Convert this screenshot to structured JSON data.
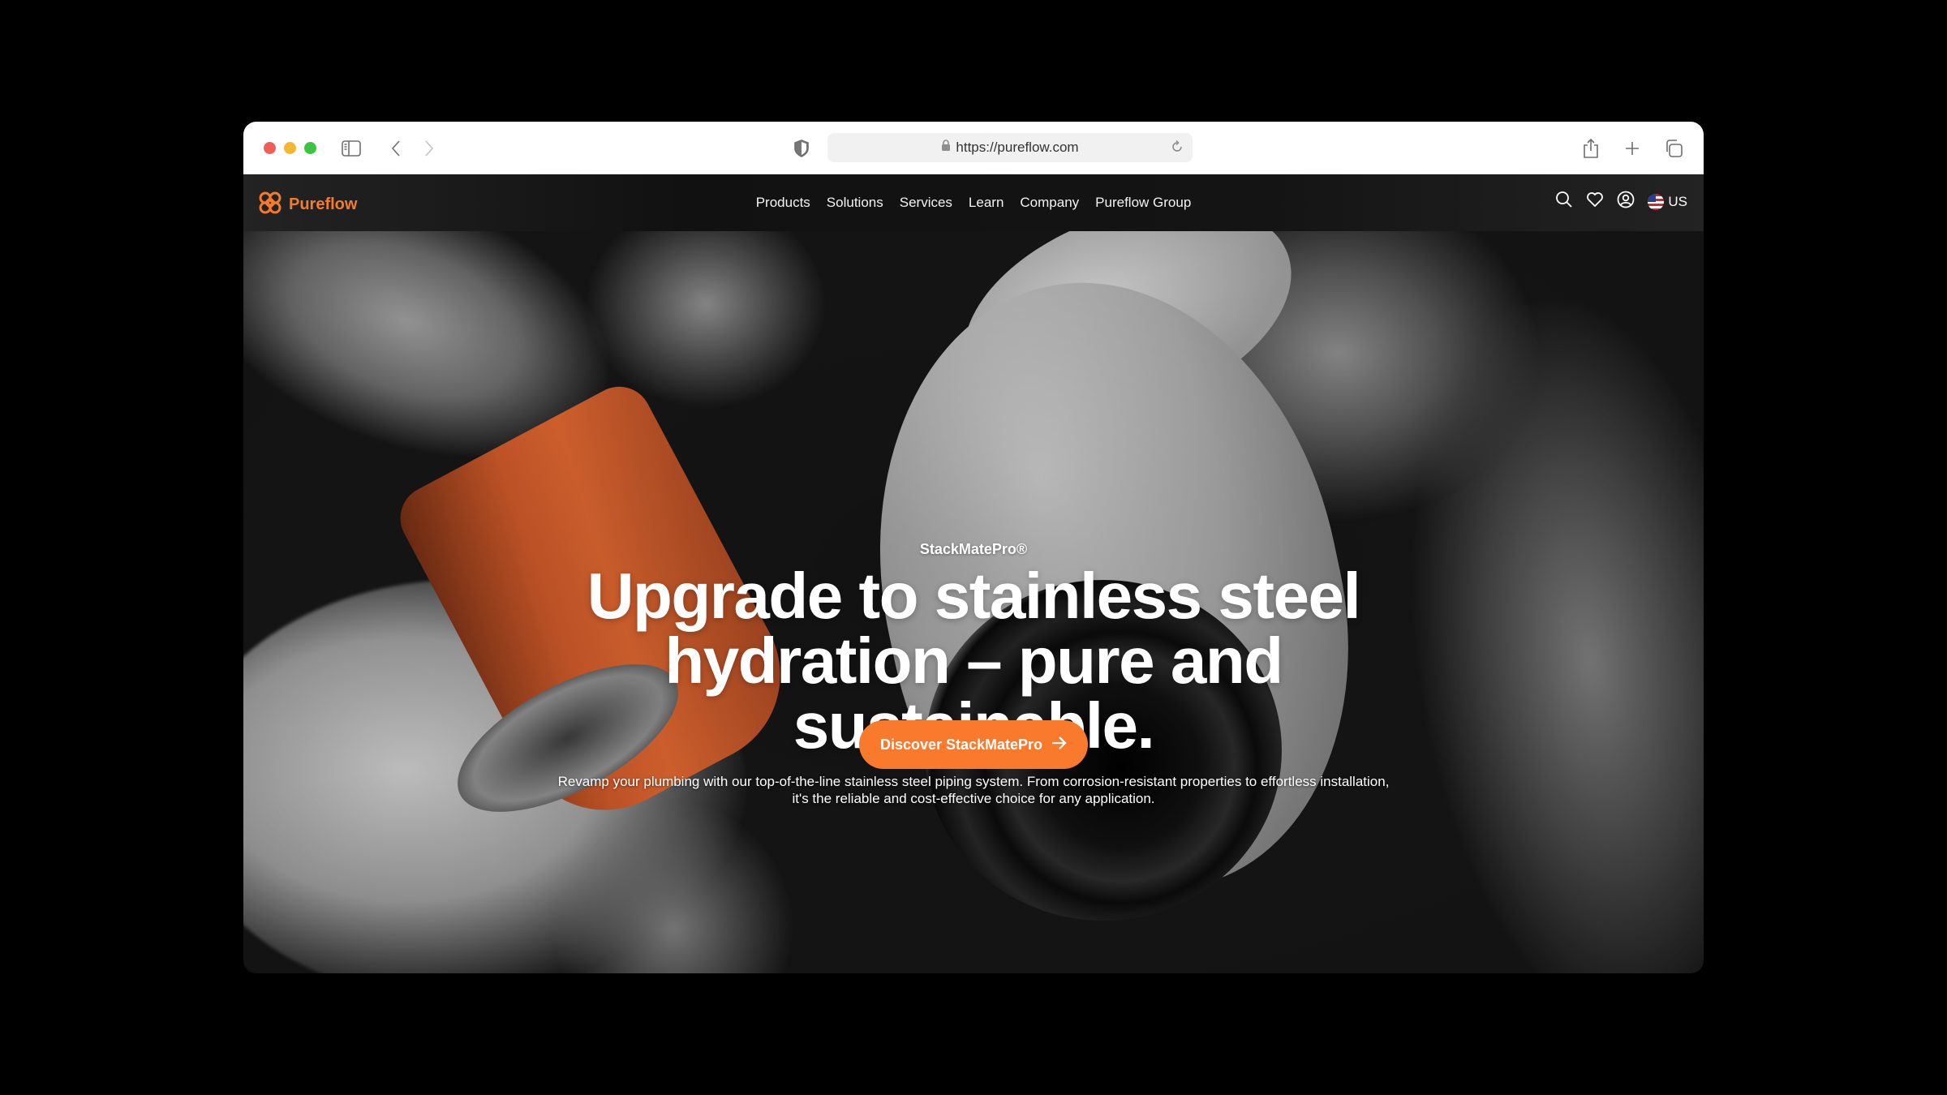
{
  "browser": {
    "url": "https://pureflow.com",
    "colors": {
      "close": "#ee5f57",
      "minimize": "#f5b731",
      "zoom": "#3dc53f"
    }
  },
  "site": {
    "brand": "Pureflow",
    "brand_color": "#f57b28",
    "nav_items": [
      "Products",
      "Solutions",
      "Services",
      "Learn",
      "Company",
      "Pureflow Group"
    ],
    "region_label": "US"
  },
  "hero": {
    "eyebrow": "StackMatePro®",
    "headline_lines": [
      "Upgrade to stainless steel",
      "hydration – pure and",
      "sustainable."
    ],
    "description": "Revamp your plumbing with our top-of-the-line stainless steel piping system. From corrosion-resistant properties to effortless installation, it's the reliable and cost-effective choice for any application.",
    "cta_label": "Discover StackMatePro",
    "cta_color": "#f97a2c"
  }
}
